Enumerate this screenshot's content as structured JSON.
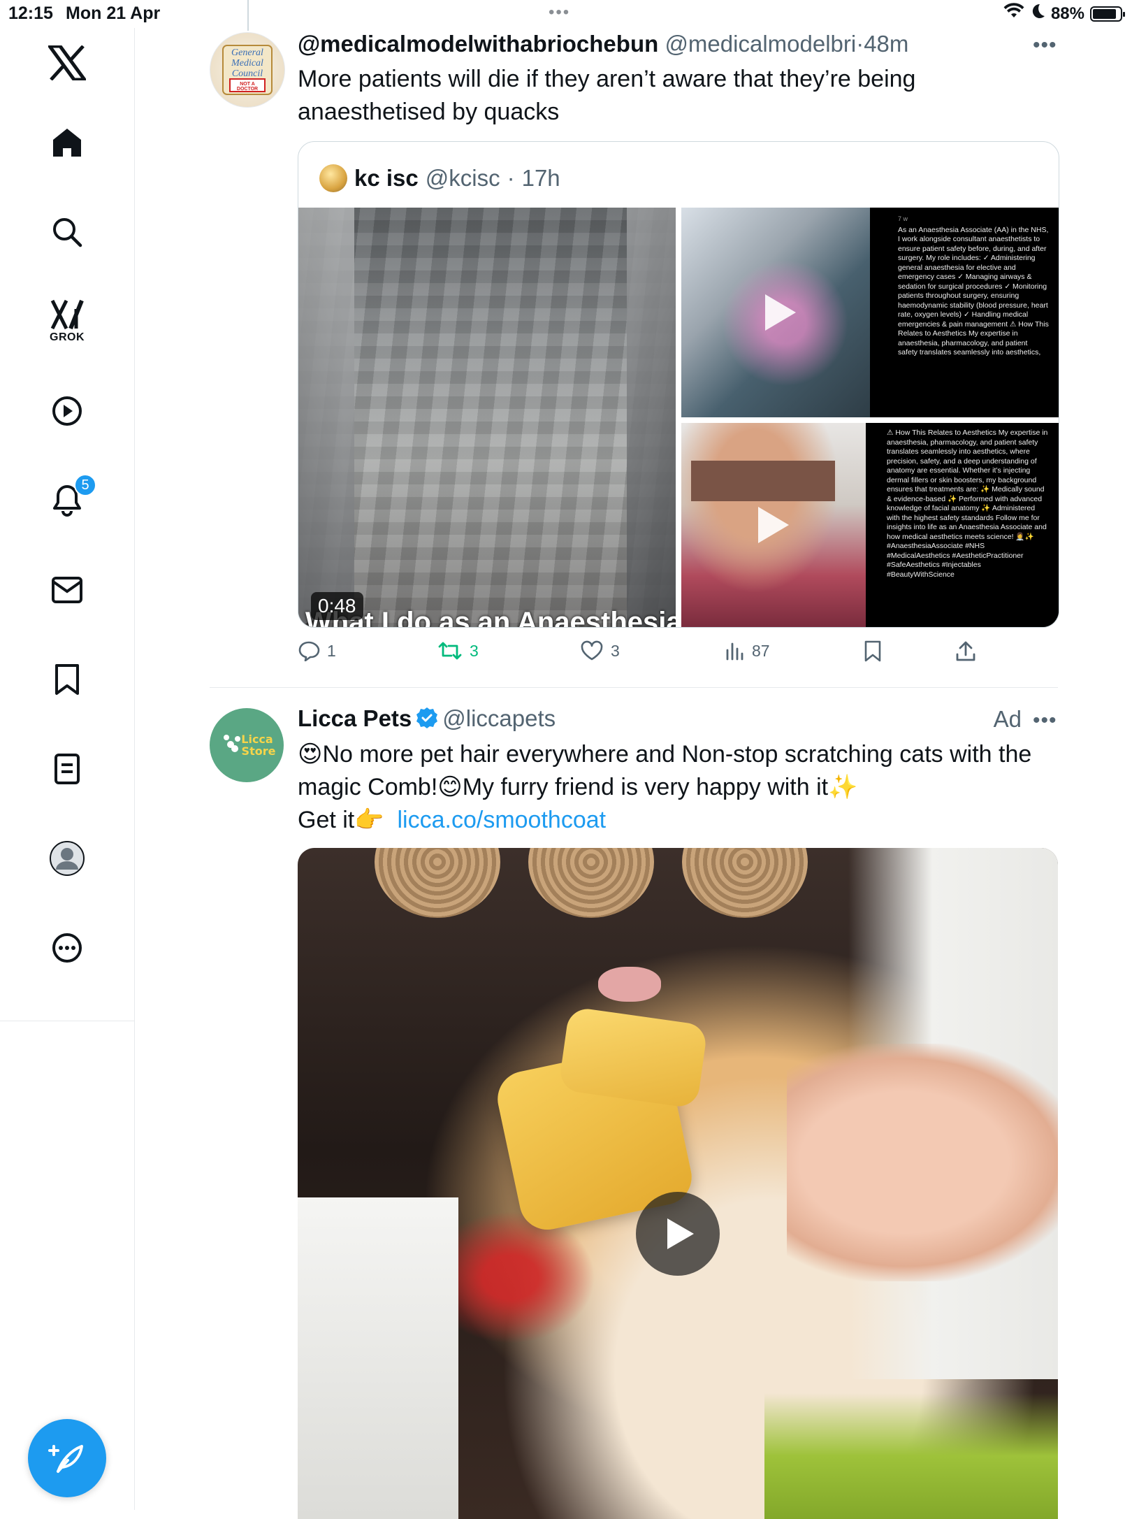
{
  "status_bar": {
    "time": "12:15",
    "date": "Mon 21 Apr",
    "battery_pct": "88%",
    "battery_level": 0.88
  },
  "sidebar": {
    "grok_label": "GROK",
    "notifications_badge": "5",
    "items": [
      "x-logo",
      "home-icon",
      "search-icon",
      "grok-icon",
      "video-icon",
      "bell-icon",
      "mail-icon",
      "bookmark-icon",
      "list-icon",
      "profile-icon",
      "more-icon"
    ]
  },
  "tweet1": {
    "name": "@medicalmodelwithabriochebun",
    "handle": "@medicalmodelbri",
    "sep": "·",
    "time": "48m",
    "text": "More patients will die if they aren’t aware that they’re being anaesthetised by quacks",
    "avatar_text": [
      "General",
      "Medical",
      "Council",
      "NOT A",
      "DOCTOR"
    ],
    "quote": {
      "name": "kc isc",
      "handle": "@kcisc",
      "sep": "·",
      "time": "17h",
      "video_duration": "0:48",
      "video_caption": "What I do as an Anaesthesia",
      "clip1_meta": "7 w",
      "clip1_text": "As an Anaesthesia Associate (AA) in the NHS, I work alongside consultant anaesthetists to ensure patient safety before, during, and after surgery. My role includes: ✓ Administering general anaesthesia for elective and emergency cases ✓ Managing airways & sedation for surgical procedures ✓ Monitoring patients throughout surgery, ensuring haemodynamic stability (blood pressure, heart rate, oxygen levels) ✓ Handling medical emergencies & pain management ⚠ How This Relates to Aesthetics My expertise in anaesthesia, pharmacology, and patient safety translates seamlessly into aesthetics,",
      "clip2_text": "⚠ How This Relates to Aesthetics My expertise in anaesthesia, pharmacology, and patient safety translates seamlessly into aesthetics, where precision, safety, and a deep understanding of anatomy are essential. Whether it’s injecting dermal fillers or skin boosters, my background ensures that treatments are: ✨ Medically sound & evidence-based ✨ Performed with advanced knowledge of facial anatomy ✨ Administered with the highest safety standards Follow me for insights into life as an Anaesthesia Associate and how medical aesthetics meets science! 👩‍⚕️✨ #AnaesthesiaAssociate #NHS #MedicalAesthetics #AestheticPractitioner #SafeAesthetics #Injectables #BeautyWithScience"
    },
    "actions": {
      "replies": "1",
      "retweets": "3",
      "likes": "3",
      "views": "87"
    }
  },
  "tweet2": {
    "name": "Licca Pets",
    "handle": "@liccapets",
    "ad_label": "Ad",
    "avatar_text": [
      "Licca",
      "Store"
    ],
    "text_line1": "😍No more pet hair everywhere and Non-stop scratching cats with the",
    "text_line2": "magic Comb!😊My furry friend is very happy with it✨",
    "text_line3": "Get it👉",
    "link": "licca.co/smoothcoat"
  },
  "colors": {
    "accent": "#1d9bf0",
    "retweet_green": "#00ba7c",
    "text_primary": "#0f1419",
    "text_secondary": "#536471"
  }
}
